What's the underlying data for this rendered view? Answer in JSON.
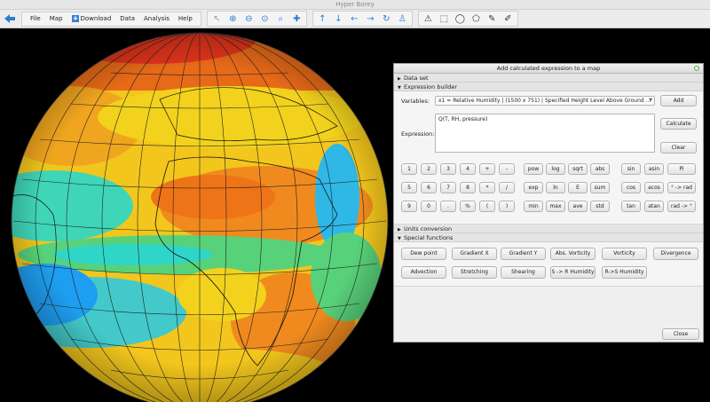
{
  "window": {
    "title": "Hyper Borey"
  },
  "menu": {
    "items": [
      {
        "label": "File"
      },
      {
        "label": "Map"
      },
      {
        "label": "Download"
      },
      {
        "label": "Data"
      },
      {
        "label": "Analysis"
      },
      {
        "label": "Help"
      }
    ]
  },
  "toolbar": {
    "groups": [
      [
        "pointer-icon",
        "zoom-in-icon",
        "zoom-out-icon",
        "zoom-fit-icon",
        "zoom-region-icon",
        "pan-add-icon"
      ],
      [
        "arrow-up-icon",
        "arrow-down-icon",
        "arrow-left-icon",
        "arrow-right-icon",
        "rotate-icon",
        "walker-icon"
      ],
      [
        "measure-icon",
        "rect-select-icon",
        "circle-select-icon",
        "polygon-select-icon",
        "edit-icon",
        "paint-icon"
      ]
    ]
  },
  "dialog": {
    "title": "Add calculated expression to a map",
    "sections": {
      "dataset": "Data set",
      "expression_builder": "Expression builder",
      "units": "Units conversion",
      "special": "Special functions"
    },
    "variables_label": "Variables:",
    "variable_value": "x1 = Relative Humidity | (1500 x 751) | Specified Height Level Above Ground ...",
    "add_label": "Add",
    "expression_label": "Expression:",
    "expression_value": "Q(T, RH, pressure)",
    "calculate_label": "Calculate",
    "clear_label": "Clear",
    "keypad": [
      [
        "1",
        "2",
        "3",
        "4",
        "+",
        "-"
      ],
      [
        "5",
        "6",
        "7",
        "8",
        "*",
        "/"
      ],
      [
        "9",
        "0",
        ".",
        "%",
        "(",
        ")"
      ]
    ],
    "functions": [
      [
        "pow",
        "log",
        "sqrt",
        "abs"
      ],
      [
        "exp",
        "ln",
        "E",
        "sum"
      ],
      [
        "min",
        "max",
        "ave",
        "std"
      ]
    ],
    "trig": [
      [
        "sin",
        "asin",
        "Pi"
      ],
      [
        "cos",
        "acos",
        "° -> rad"
      ],
      [
        "tan",
        "atan",
        "rad -> °"
      ]
    ],
    "special_functions": [
      [
        "Dew point",
        "Gradient X",
        "Gradient Y",
        "Abs. Vorticity",
        "Vorticity",
        "Divergence"
      ],
      [
        "Advection",
        "Stretching",
        "Shearing",
        "S -> R Humidity",
        "R->S Humidity"
      ]
    ],
    "close_label": "Close"
  },
  "colors": {
    "accent": "#2a7bd3",
    "globe_red": "#e0341b",
    "globe_orange": "#f08a1e",
    "globe_yellow": "#f2d21c",
    "globe_green": "#58d27a",
    "globe_cyan": "#2fd6c8",
    "globe_blue": "#1e6cf0"
  }
}
